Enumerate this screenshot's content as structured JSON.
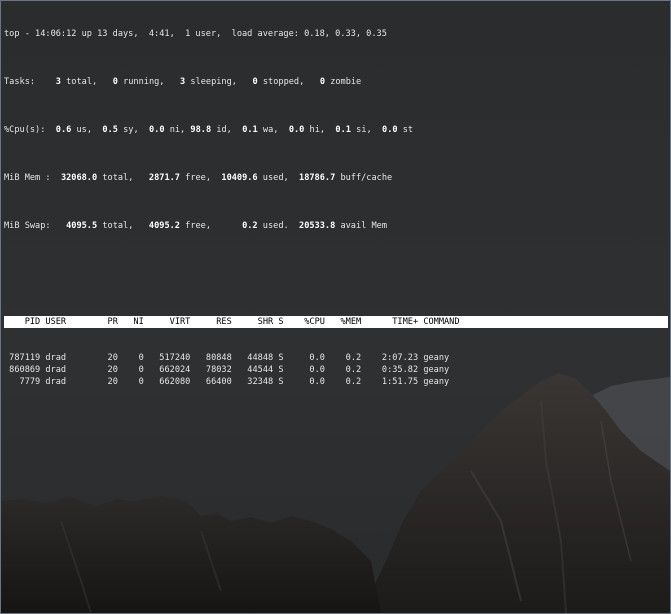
{
  "summary": {
    "line1": "top - 14:06:12 up 13 days,  4:41,  1 user,  load average: 0.18, 0.33, 0.35",
    "tasks": {
      "label": "Tasks:",
      "total": "3",
      "total_label": "total,",
      "running": "0",
      "running_label": "running,",
      "sleeping": "3",
      "sleeping_label": "sleeping,",
      "stopped": "0",
      "stopped_label": "stopped,",
      "zombie": "0",
      "zombie_label": "zombie"
    },
    "cpu": {
      "label": "%Cpu(s):",
      "us": "0.6",
      "us_label": "us,",
      "sy": "0.5",
      "sy_label": "sy,",
      "ni": "0.0",
      "ni_label": "ni,",
      "id": "98.8",
      "id_label": "id,",
      "wa": "0.1",
      "wa_label": "wa,",
      "hi": "0.0",
      "hi_label": "hi,",
      "si": "0.1",
      "si_label": "si,",
      "st": "0.0",
      "st_label": "st"
    },
    "mem": {
      "label": "MiB Mem :",
      "total": "32068.0",
      "total_label": "total,",
      "free": "2871.7",
      "free_label": "free,",
      "used": "10409.6",
      "used_label": "used,",
      "buff": "18786.7",
      "buff_label": "buff/cache"
    },
    "swap": {
      "label": "MiB Swap:",
      "total": "4095.5",
      "total_label": "total,",
      "free": "4095.2",
      "free_label": "free,",
      "used": "0.2",
      "used_label": "used.",
      "avail": "20533.8",
      "avail_label": "avail Mem"
    }
  },
  "table": {
    "columns": [
      "PID",
      "USER",
      "PR",
      "NI",
      "VIRT",
      "RES",
      "SHR",
      "S",
      "%CPU",
      "%MEM",
      "TIME+",
      "COMMAND"
    ],
    "rows": [
      [
        "787119",
        "drad",
        "20",
        "0",
        "517240",
        "80848",
        "44848",
        "S",
        "0.0",
        "0.2",
        "2:07.23",
        "geany"
      ],
      [
        "860869",
        "drad",
        "20",
        "0",
        "662024",
        "78032",
        "44544",
        "S",
        "0.0",
        "0.2",
        "0:35.82",
        "geany"
      ],
      [
        "7779",
        "drad",
        "20",
        "0",
        "662080",
        "66400",
        "32348",
        "S",
        "0.0",
        "0.2",
        "1:51.75",
        "geany"
      ]
    ]
  }
}
